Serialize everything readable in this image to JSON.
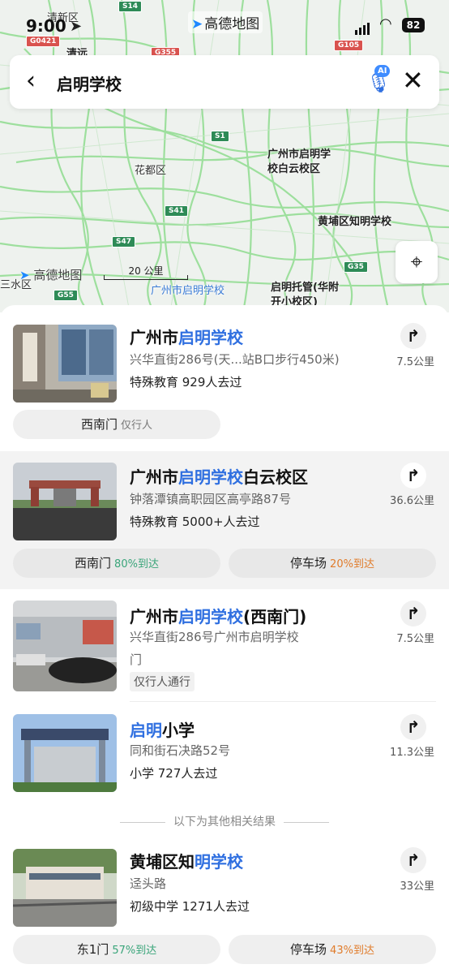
{
  "status_bar": {
    "time": "9:00",
    "battery": "82"
  },
  "brand_top": "高德地图",
  "search": {
    "query": "启明学校"
  },
  "map": {
    "labels": {
      "qingxin": "清新区",
      "qingyuan": "清远",
      "huadu": "花都区",
      "baiyun_campus": "广州市启明学\n校白云校区",
      "huangpu": "黄埔区知明学校",
      "guangzhou": "广州市启明学校",
      "tuoguan": "启明托管(华附\n开小校区)",
      "sanshui": "三水区"
    },
    "shields": [
      "S14",
      "G0421",
      "G355",
      "G105",
      "S1",
      "S41",
      "S47",
      "G35",
      "G55"
    ],
    "brand": "高德地图",
    "scale": "20 公里"
  },
  "results": [
    {
      "title_prefix": "广州市",
      "title_hl": "启明学校",
      "title_suffix": "",
      "address": "兴华直街286号(天...站B口步行450米)",
      "meta": "特殊教育  929人去过",
      "distance": "7.5公里",
      "pills": [
        {
          "label": "西南门",
          "sub": "仅行人",
          "sub_color": "gray"
        }
      ]
    },
    {
      "title_prefix": "广州市",
      "title_hl": "启明学校",
      "title_suffix": "白云校区",
      "address": "钟落潭镇高职园区高亭路87号",
      "meta": "特殊教育  5000+人去过",
      "distance": "36.6公里",
      "pills": [
        {
          "label": "西南门",
          "sub": "80%到达",
          "sub_color": "green"
        },
        {
          "label": "停车场",
          "sub": "20%到达",
          "sub_color": "orange"
        }
      ]
    },
    {
      "title_prefix": "广州市",
      "title_hl": "启明学校",
      "title_suffix": "(西南门)",
      "address_line1": "兴华直街286号广州市启明学校",
      "address_line2": "门",
      "tag": "仅行人通行",
      "distance": "7.5公里"
    },
    {
      "title_prefix": "",
      "title_hl": "启明",
      "title_suffix": "小学",
      "address": "同和街石决路52号",
      "meta": "小学  727人去过",
      "distance": "11.3公里"
    },
    {
      "title_prefix": "黄埔区知",
      "title_hl": "明学校",
      "title_suffix": "",
      "address": "迳头路",
      "meta": "初级中学  1271人去过",
      "distance": "33公里",
      "pills": [
        {
          "label": "东1门",
          "sub": "57%到达",
          "sub_color": "green"
        },
        {
          "label": "停车场",
          "sub": "43%到达",
          "sub_color": "orange"
        }
      ]
    }
  ],
  "separator": "以下为其他相关结果",
  "colors": {
    "accent": "#2f6fe0",
    "road": "#7fd67f",
    "green_text": "#3aa57a",
    "orange_text": "#e07b2a"
  }
}
